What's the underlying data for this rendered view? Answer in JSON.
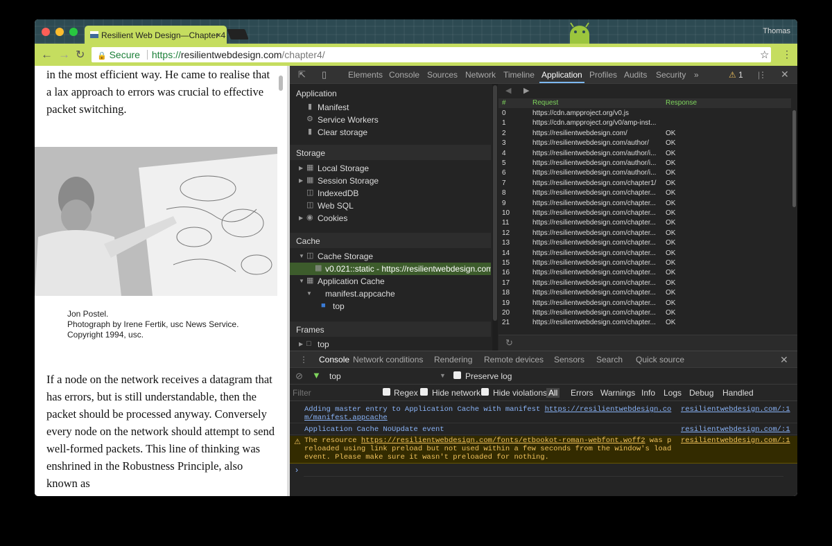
{
  "browser": {
    "tab_title": "Resilient Web Design—Chapter 4",
    "tab_close": "×",
    "user_name": "Thomas",
    "secure_label": "Secure",
    "url_scheme": "https://",
    "url_host": "resilientwebdesign.com",
    "url_path": "/chapter4/",
    "colors": {
      "toolbar": "#c5dd5f",
      "secure": "#1a7f37"
    }
  },
  "page": {
    "para1": "in the most efficient way. He came to realise that a lax approach to errors was crucial to effective packet switching.",
    "caption_line1": "Jon Postel.",
    "caption_line2": "Photograph by Irene Fertik, usc News Service.",
    "caption_line3": "Copyright 1994, usc.",
    "para2": "If a node on the network receives a datagram that has errors, but is still understandable, then the packet should be processed anyway. Conversely every node on the network should attempt to send well-formed packets. This line of thinking was enshrined in the Robustness Principle, also known as"
  },
  "devtools": {
    "tabs": [
      "Elements",
      "Console",
      "Sources",
      "Network",
      "Timeline",
      "Application",
      "Profiles",
      "Audits",
      "Security"
    ],
    "active_tab": "Application",
    "more": "»",
    "warning_count": "1",
    "sidebar": {
      "section_application": "Application",
      "manifest": "Manifest",
      "service_workers": "Service Workers",
      "clear_storage": "Clear storage",
      "section_storage": "Storage",
      "local_storage": "Local Storage",
      "session_storage": "Session Storage",
      "indexeddb": "IndexedDB",
      "websql": "Web SQL",
      "cookies": "Cookies",
      "section_cache": "Cache",
      "cache_storage": "Cache Storage",
      "cache_entry": "v0.021::static - https://resilientwebdesign.com",
      "application_cache": "Application Cache",
      "manifest_appcache": "manifest.appcache",
      "top_frame": "top",
      "section_frames": "Frames",
      "frames_top": "top"
    },
    "cache_table": {
      "headers": {
        "num": "#",
        "request": "Request",
        "response": "Response"
      },
      "rows": [
        {
          "n": "0",
          "req": "https://cdn.ampproject.org/v0.js",
          "res": ""
        },
        {
          "n": "1",
          "req": "https://cdn.ampproject.org/v0/amp-inst...",
          "res": ""
        },
        {
          "n": "2",
          "req": "https://resilientwebdesign.com/",
          "res": "OK"
        },
        {
          "n": "3",
          "req": "https://resilientwebdesign.com/author/",
          "res": "OK"
        },
        {
          "n": "4",
          "req": "https://resilientwebdesign.com/author/i...",
          "res": "OK"
        },
        {
          "n": "5",
          "req": "https://resilientwebdesign.com/author/i...",
          "res": "OK"
        },
        {
          "n": "6",
          "req": "https://resilientwebdesign.com/author/i...",
          "res": "OK"
        },
        {
          "n": "7",
          "req": "https://resilientwebdesign.com/chapter1/",
          "res": "OK"
        },
        {
          "n": "8",
          "req": "https://resilientwebdesign.com/chapter...",
          "res": "OK"
        },
        {
          "n": "9",
          "req": "https://resilientwebdesign.com/chapter...",
          "res": "OK"
        },
        {
          "n": "10",
          "req": "https://resilientwebdesign.com/chapter...",
          "res": "OK"
        },
        {
          "n": "11",
          "req": "https://resilientwebdesign.com/chapter...",
          "res": "OK"
        },
        {
          "n": "12",
          "req": "https://resilientwebdesign.com/chapter...",
          "res": "OK"
        },
        {
          "n": "13",
          "req": "https://resilientwebdesign.com/chapter...",
          "res": "OK"
        },
        {
          "n": "14",
          "req": "https://resilientwebdesign.com/chapter...",
          "res": "OK"
        },
        {
          "n": "15",
          "req": "https://resilientwebdesign.com/chapter...",
          "res": "OK"
        },
        {
          "n": "16",
          "req": "https://resilientwebdesign.com/chapter...",
          "res": "OK"
        },
        {
          "n": "17",
          "req": "https://resilientwebdesign.com/chapter...",
          "res": "OK"
        },
        {
          "n": "18",
          "req": "https://resilientwebdesign.com/chapter...",
          "res": "OK"
        },
        {
          "n": "19",
          "req": "https://resilientwebdesign.com/chapter...",
          "res": "OK"
        },
        {
          "n": "20",
          "req": "https://resilientwebdesign.com/chapter...",
          "res": "OK"
        },
        {
          "n": "21",
          "req": "https://resilientwebdesign.com/chapter...",
          "res": "OK"
        }
      ]
    },
    "drawer": {
      "tabs": [
        "Console",
        "Network conditions",
        "Rendering",
        "Remote devices",
        "Sensors",
        "Search",
        "Quick source"
      ],
      "active_tab": "Console",
      "context": "top",
      "preserve_log": "Preserve log",
      "filter_placeholder": "Filter",
      "regex": "Regex",
      "hide_network": "Hide network",
      "hide_violations": "Hide violations",
      "levels": [
        "All",
        "Errors",
        "Warnings",
        "Info",
        "Logs",
        "Debug",
        "Handled"
      ]
    },
    "console": {
      "messages": [
        {
          "pre": "Adding master entry to Application Cache with manifest ",
          "link": "https://resilientwebdesign.com/manifest.appcache",
          "post": "",
          "source": "resilientwebdesign.com/:1"
        },
        {
          "pre": "Application Cache NoUpdate event",
          "link": "",
          "post": "",
          "source": "resilientwebdesign.com/:1"
        },
        {
          "pre": "The resource ",
          "link": "https://resilientwebdesign.com/fonts/etbookot-roman-webfont.woff2",
          "post": " was preloaded using link preload but not used within a few seconds from the window's load event. Please make sure it wasn't preloaded for nothing.",
          "source": "resilientwebdesign.com/:1"
        }
      ],
      "prompt": "›"
    }
  }
}
